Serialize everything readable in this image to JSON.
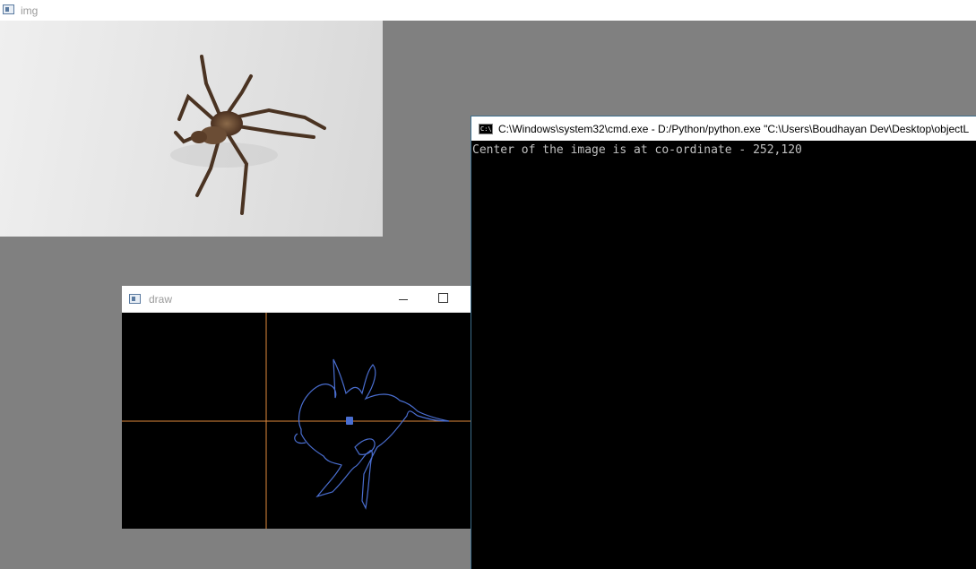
{
  "img_window": {
    "title": "img",
    "icon": "app-window-icon"
  },
  "draw_window": {
    "title": "draw",
    "icon": "app-window-icon",
    "controls": [
      "minimize-icon",
      "maximize-icon"
    ],
    "crosshair_color": "#e08a3c",
    "contour_color": "#4a6ed0"
  },
  "cmd_window": {
    "title": "C:\\Windows\\system32\\cmd.exe - D:/Python/python.exe  \"C:\\Users\\Boudhayan Dev\\Desktop\\objectL",
    "icon_text": "C:\\",
    "output_line": "Center of the image is at co-ordinate - 252,120"
  }
}
